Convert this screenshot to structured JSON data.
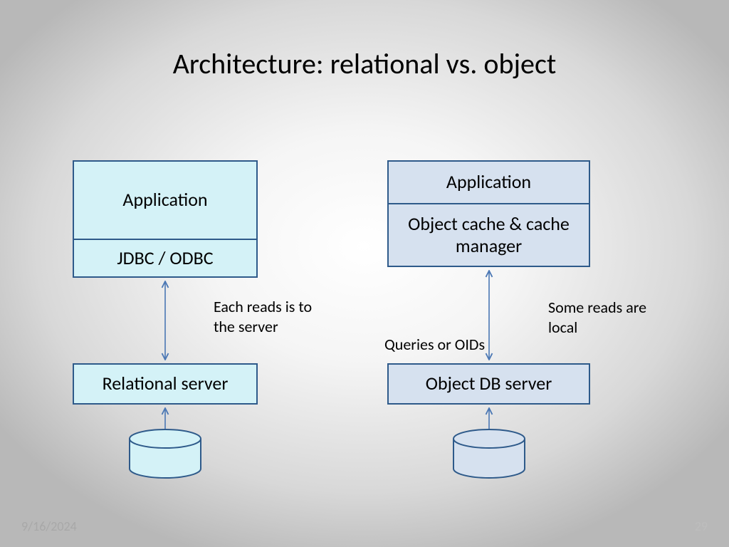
{
  "title": "Architecture: relational vs. object",
  "left": {
    "app": "Application",
    "driver": "JDBC / ODBC",
    "server": "Relational server",
    "annot": "Each reads is to the server"
  },
  "right": {
    "app": "Application",
    "cache": "Object cache & cache manager",
    "server": "Object DB server",
    "annot_left": "Queries or OIDs",
    "annot_right": "Some reads are local"
  },
  "footer": {
    "date": "9/16/2024",
    "page": "29"
  },
  "colors": {
    "border": "#2e5a8a",
    "arrow": "#4a77b4",
    "left_fill": "#d4f2f7",
    "right_fill": "#d6e1ef"
  }
}
